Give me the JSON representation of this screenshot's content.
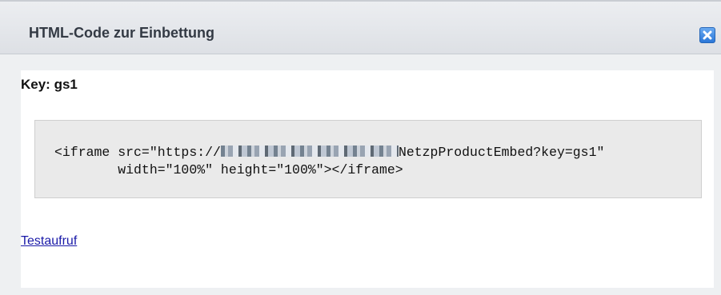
{
  "dialog": {
    "title": "HTML-Code zur Einbettung",
    "close_icon": "close-icon",
    "accent_color": "#2a77d8"
  },
  "content": {
    "key_label": "Key: gs1",
    "code": {
      "line1_prefix": "<iframe src=\"https://",
      "line1_suffix": "NetzpProductEmbed?key=gs1\"",
      "line2": "        width=\"100%\" height=\"100%\"></iframe>"
    },
    "test_link": "Testaufruf"
  }
}
